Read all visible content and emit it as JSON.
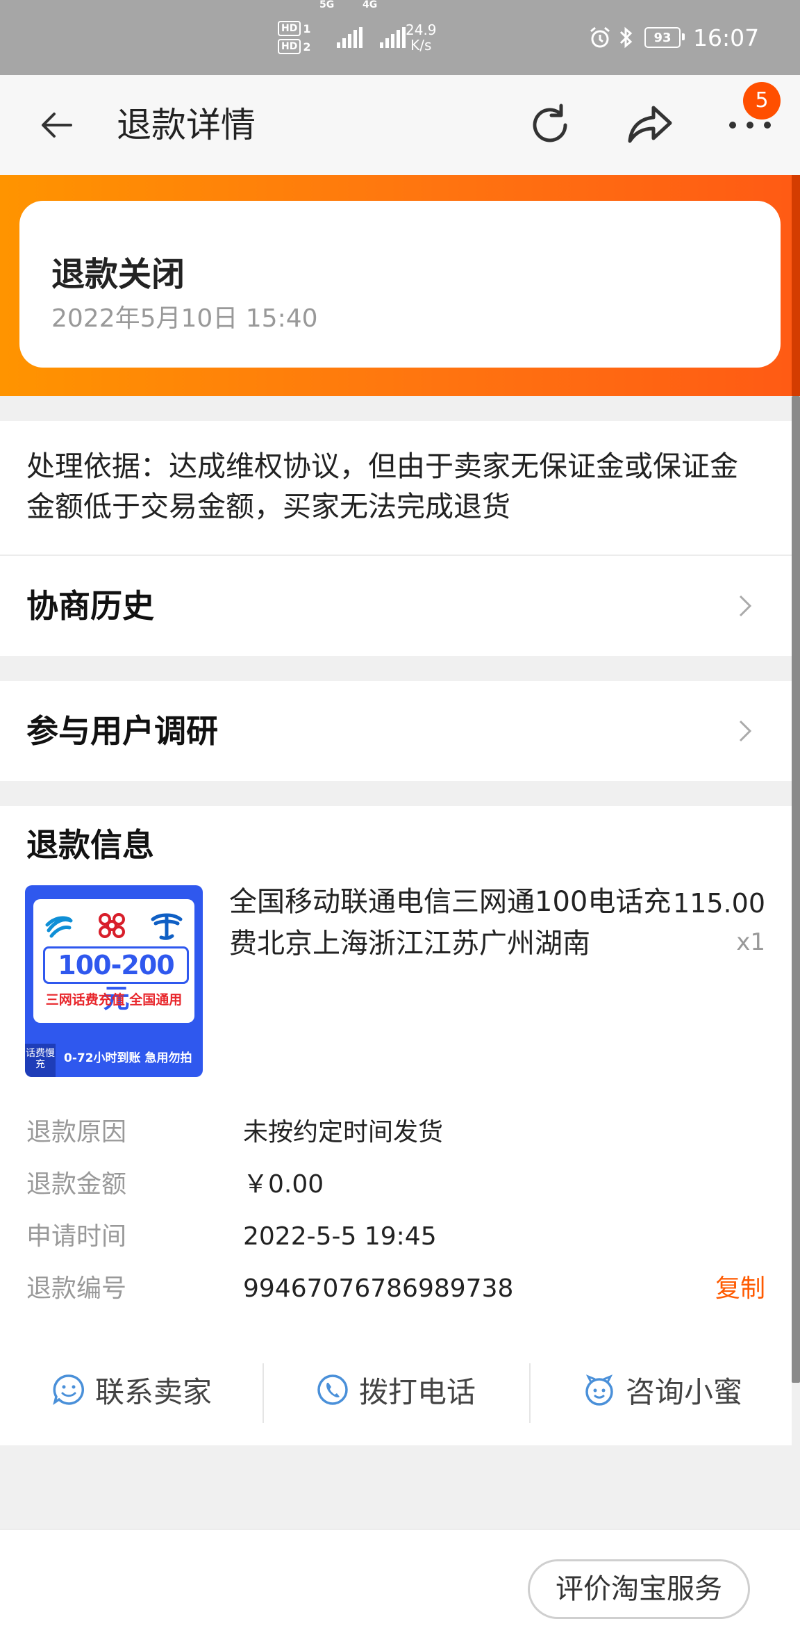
{
  "status_bar": {
    "hd1": "HD",
    "sim1": "1",
    "hd2": "HD",
    "sim2": "2",
    "net1": "5G",
    "net2": "4G",
    "speed_value": "24.9",
    "speed_unit": "K/s",
    "battery": "93",
    "time": "16:07"
  },
  "header": {
    "title": "退款详情",
    "notification_count": "5"
  },
  "refund_status": {
    "title": "退款关闭",
    "datetime": "2022年5月10日 15:40"
  },
  "basis_text": "处理依据：达成维权协议，但由于卖家无保证金或保证金金额低于交易金额，买家无法完成退货",
  "rows": {
    "history": "协商历史",
    "survey": "参与用户调研"
  },
  "refund_info": {
    "section_title": "退款信息",
    "product": {
      "name": "全国移动联通电信三网通100电话充费北京上海浙江江苏广州湖南",
      "price": "115.00",
      "quantity": "x1",
      "thumb_amount": "100-200元",
      "thumb_subtitle": "三网话费充值 全国通用",
      "thumb_badge": "话费慢充",
      "thumb_eta": "0-72小时到账 急用勿拍"
    },
    "fields": [
      {
        "label": "退款原因",
        "value": "未按约定时间发货"
      },
      {
        "label": "退款金额",
        "value": "￥0.00"
      },
      {
        "label": "申请时间",
        "value": "2022-5-5 19:45"
      },
      {
        "label": "退款编号",
        "value": "99467076786989738"
      }
    ],
    "copy_label": "复制"
  },
  "actions": {
    "contact_seller": "联系卖家",
    "call_phone": "拨打电话",
    "ask_xiaomi": "咨询小蜜"
  },
  "footer": {
    "evaluate": "评价淘宝服务"
  },
  "colors": {
    "accent_orange": "#ff5a00",
    "banner_start": "#ff9400",
    "banner_end": "#ff5a14",
    "icon_blue": "#4a90d9"
  }
}
